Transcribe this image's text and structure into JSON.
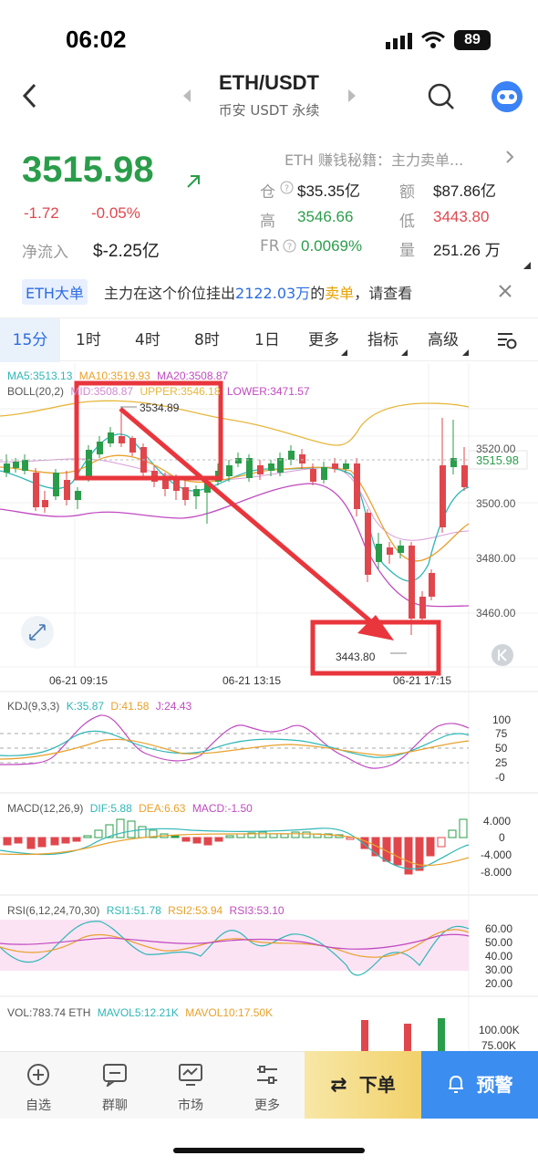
{
  "status": {
    "time": "06:02",
    "battery": "89"
  },
  "header": {
    "symbol": "ETH/USDT",
    "exchange": "币安 USDT 永续"
  },
  "ticker": {
    "last_price": "3515.98",
    "change": "-1.72",
    "change_pct": "-0.05%",
    "net_inflow_label": "净流入",
    "net_inflow_value": "$-2.25亿",
    "promo": "ETH 赚钱秘籍：主力卖单...",
    "oi_label": "仓",
    "oi_value": "$35.35亿",
    "amount_label": "额",
    "amount_value": "$87.86亿",
    "high_label": "高",
    "high_value": "3546.66",
    "low_label": "低",
    "low_value": "3443.80",
    "fr_label": "FR",
    "fr_value": "0.0069%",
    "vol_label": "量",
    "vol_value": "251.26 万"
  },
  "notice": {
    "tag": "ETH大单",
    "text_pre": "主力在这个价位挂出",
    "amount": "2122.03万",
    "text_mid": "的",
    "side": "卖单",
    "text_post": "，请查看"
  },
  "tabs": [
    "15分",
    "1时",
    "4时",
    "8时",
    "1日",
    "更多",
    "指标",
    "高级"
  ],
  "chart": {
    "ma_line": {
      "ma5": "MA5:3513.13",
      "ma10": "MA10:3519.93",
      "ma20": "MA20:3508.87"
    },
    "boll_line": {
      "name": "BOLL(20,2)",
      "mid": "MID:3508.87",
      "upper": "UPPER:3546.18",
      "lower": "LOWER:3471.57"
    },
    "annotation_high": "3534.89",
    "annotation_low": "3443.80",
    "y_ticks": [
      "3520.00",
      "3500.00",
      "3480.00",
      "3460.00"
    ],
    "current_price_tag": "3515.98",
    "x_ticks": [
      "06-21 09:15",
      "06-21 13:15",
      "06-21 17:15"
    ],
    "kdj": {
      "name": "KDJ(9,3,3)",
      "k": "K:35.87",
      "d": "D:41.58",
      "j": "J:24.43",
      "ticks": [
        "100",
        "75",
        "50",
        "25",
        "-0"
      ]
    },
    "macd": {
      "name": "MACD(12,26,9)",
      "dif": "DIF:5.88",
      "dea": "DEA:6.63",
      "macd": "MACD:-1.50",
      "ticks": [
        "4.000",
        "0",
        "-4.000",
        "-8.000"
      ]
    },
    "rsi": {
      "name": "RSI(6,12,24,70,30)",
      "rsi1": "RSI1:51.78",
      "rsi2": "RSI2:53.94",
      "rsi3": "RSI3:53.10",
      "ticks": [
        "60.00",
        "50.00",
        "40.00",
        "30.00",
        "20.00"
      ]
    },
    "vol": {
      "name": "VOL:783.74 ETH",
      "mavol5": "MAVOL5:12.21K",
      "mavol10": "MAVOL10:17.50K",
      "ticks": [
        "100.00K",
        "75.00K"
      ]
    }
  },
  "bottom_nav": {
    "watchlist": "自选",
    "group_chat": "群聊",
    "market": "市场",
    "more": "更多",
    "order": "下单",
    "alert": "预警"
  },
  "colors": {
    "up": "#2a9d4a",
    "down": "#e0474c",
    "accent": "#2d6cdf",
    "annotation": "#e8363c"
  }
}
